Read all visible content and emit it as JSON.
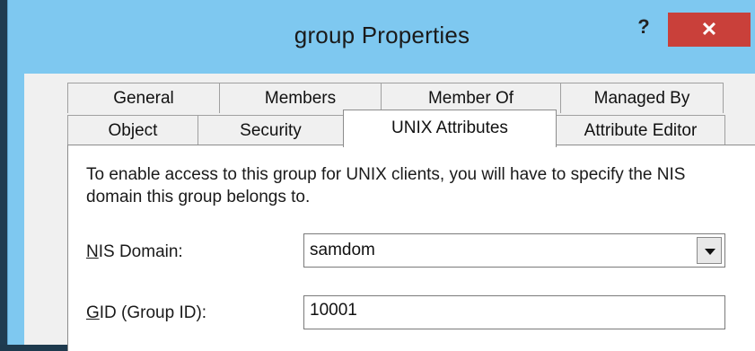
{
  "window": {
    "title": "group Properties",
    "help_label": "?",
    "close_label": "✕"
  },
  "tabs": {
    "row1": [
      {
        "label": "General"
      },
      {
        "label": "Members"
      },
      {
        "label": "Member Of"
      },
      {
        "label": "Managed By"
      }
    ],
    "row2": [
      {
        "label": "Object"
      },
      {
        "label": "Security"
      },
      {
        "label": "UNIX Attributes",
        "active": true
      },
      {
        "label": "Attribute Editor"
      }
    ]
  },
  "panel": {
    "description": "To enable access to this group for UNIX clients, you will have to specify the NIS domain this group belongs to.",
    "nis_domain": {
      "label_accel": "N",
      "label_rest": "IS Domain:",
      "value": "samdom"
    },
    "gid": {
      "label_accel": "G",
      "label_rest": "ID (Group ID):",
      "value": "10001"
    }
  }
}
